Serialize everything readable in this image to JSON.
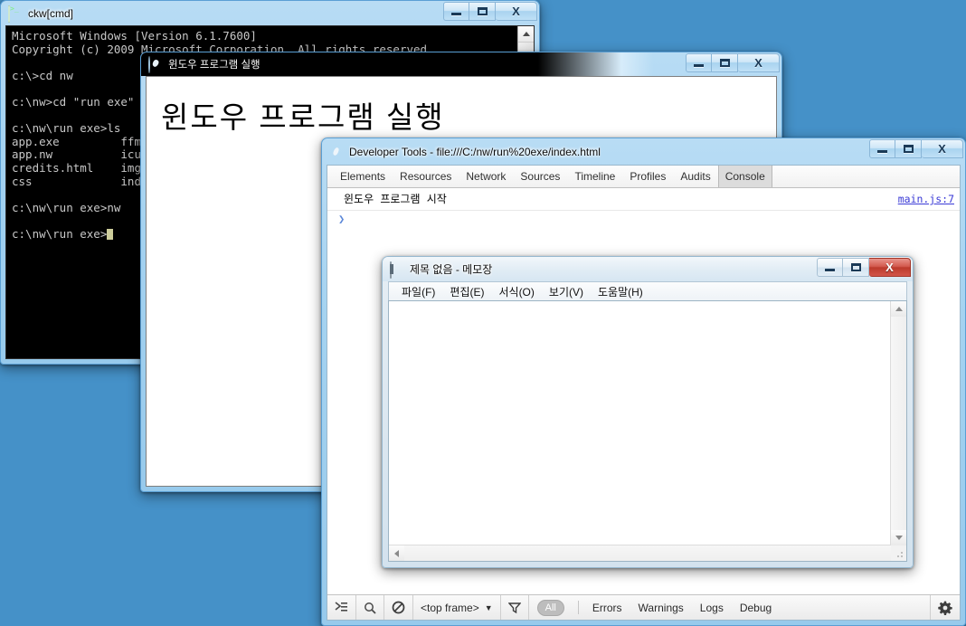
{
  "desktop": {
    "background_color": "#4591c8"
  },
  "cmd_window": {
    "title": "ckw[cmd]",
    "icon": "console-icon",
    "buttons": {
      "minimize": "–",
      "maximize": "□",
      "close": "X"
    },
    "content": "Microsoft Windows [Version 6.1.7600]\nCopyright (c) 2009 Microsoft Corporation. All rights reserved.\n\nc:\\>cd nw\n\nc:\\nw>cd \"run exe\"\n\nc:\\nw\\run exe>ls\napp.exe         ffmpegs\napp.nw          icudt.\ncredits.html    img\ncss             index.\n\nc:\\nw\\run exe>nw\n\nc:\\nw\\run exe>"
  },
  "nw_window": {
    "title": "윈도우 프로그램 실행",
    "icon": "nw-app-icon",
    "heading": "윈도우 프로그램 실행",
    "buttons": {
      "minimize": "–",
      "maximize": "□",
      "close": "X"
    }
  },
  "devtools_window": {
    "title": "Developer Tools - file:///C:/nw/run%20exe/index.html",
    "icon": "devtools-icon",
    "buttons": {
      "minimize": "–",
      "maximize": "□",
      "close": "X"
    },
    "tabs": [
      {
        "label": "Elements",
        "active": false
      },
      {
        "label": "Resources",
        "active": false
      },
      {
        "label": "Network",
        "active": false
      },
      {
        "label": "Sources",
        "active": false
      },
      {
        "label": "Timeline",
        "active": false
      },
      {
        "label": "Profiles",
        "active": false
      },
      {
        "label": "Audits",
        "active": false
      },
      {
        "label": "Console",
        "active": true
      }
    ],
    "console": {
      "messages": [
        {
          "text": "윈도우 프로그램 시작",
          "source": "main.js:7"
        }
      ],
      "prompt_symbol": "❯"
    },
    "statusbar": {
      "console_toggle_icon": "console-drawer-icon",
      "search_icon": "search-icon",
      "clear_icon": "clear-console-icon",
      "frame_selector": "<top frame>",
      "frame_selector_caret": "▼",
      "filter_icon": "filter-funnel-icon",
      "all_label": "All",
      "filters": [
        "Errors",
        "Warnings",
        "Logs",
        "Debug"
      ],
      "settings_icon": "gear-icon"
    }
  },
  "notepad_window": {
    "title": "제목 없음 - 메모장",
    "icon": "notepad-icon",
    "buttons": {
      "minimize": "–",
      "maximize": "□",
      "close": "X"
    },
    "menu": [
      "파일(F)",
      "편집(E)",
      "서식(O)",
      "보기(V)",
      "도움말(H)"
    ],
    "text_content": ""
  }
}
